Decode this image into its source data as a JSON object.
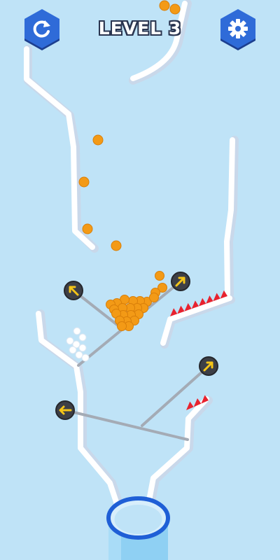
{
  "hud": {
    "level_label": "LEVEL 3",
    "restart_icon": "restart-icon",
    "settings_icon": "gear-icon"
  },
  "colors": {
    "background": "#bfe3f7",
    "wall": "#ffffff",
    "wall_shade": "#c9d8ea",
    "pin": "#a4abb5",
    "pin_knob": "#3d3f46",
    "pin_arrow": "#f5c518",
    "ball_orange": "#f39a16",
    "ball_white": "#ffffff",
    "spike": "#e8222e",
    "cup_rim": "#1f5fd6",
    "cup_body": "#8fd0f3",
    "button": "#2f6bd8",
    "button_dark": "#1d3f8f"
  },
  "pins": [
    {
      "name": "pin-left-upper",
      "arrow": "up-left"
    },
    {
      "name": "pin-right-upper",
      "arrow": "up-right"
    },
    {
      "name": "pin-right-lower",
      "arrow": "up-right"
    },
    {
      "name": "pin-left-lower",
      "arrow": "left"
    }
  ],
  "balls": {
    "orange_in_bowl": 24,
    "orange_falling": 6,
    "white_in_pit": 8
  }
}
